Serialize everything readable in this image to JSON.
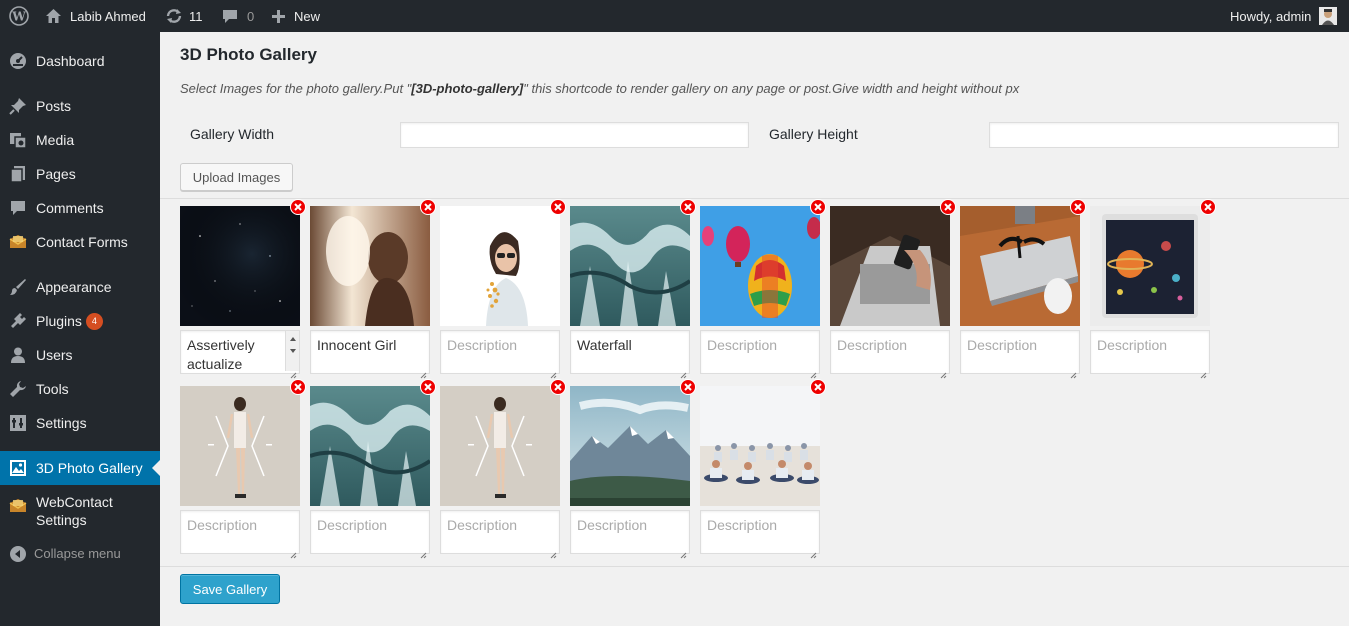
{
  "adminbar": {
    "site_name": "Labib Ahmed",
    "updates_count": "11",
    "comments_count": "0",
    "new_label": "New",
    "greeting": "Howdy, admin"
  },
  "sidebar": {
    "items": [
      {
        "label": "Dashboard",
        "icon": "dashboard-icon"
      },
      {
        "label": "Posts",
        "icon": "pin-icon"
      },
      {
        "label": "Media",
        "icon": "media-icon"
      },
      {
        "label": "Pages",
        "icon": "pages-icon"
      },
      {
        "label": "Comments",
        "icon": "comment-icon"
      },
      {
        "label": "Contact Forms",
        "icon": "contact-form-icon"
      },
      {
        "label": "Appearance",
        "icon": "brush-icon"
      },
      {
        "label": "Plugins",
        "icon": "plugin-icon",
        "badge": "4"
      },
      {
        "label": "Users",
        "icon": "users-icon"
      },
      {
        "label": "Tools",
        "icon": "wrench-icon"
      },
      {
        "label": "Settings",
        "icon": "settings-icon"
      },
      {
        "label": "3D Photo Gallery",
        "icon": "gallery-icon"
      },
      {
        "label": "WebContact Settings",
        "icon": "contact-form-icon"
      },
      {
        "label": "Collapse menu",
        "icon": "collapse-icon"
      }
    ],
    "active": "3D Photo Gallery"
  },
  "page": {
    "title": "3D Photo Gallery",
    "description_pre": "Select Images for the photo gallery.Put \"",
    "description_code": "[3D-photo-gallery]",
    "description_post": "\" this shortcode to render gallery on any page or post.Give width and height without px",
    "width_label": "Gallery Width",
    "width_value": "",
    "height_label": "Gallery Height",
    "height_value": "",
    "upload_button": "Upload Images",
    "save_button": "Save Gallery"
  },
  "gallery": {
    "placeholder": "Description",
    "items": [
      {
        "image": "night-sky-stars",
        "description": "Assertively actualize"
      },
      {
        "image": "woman-sunlight-silhouette",
        "description": "Innocent Girl"
      },
      {
        "image": "woman-sunglasses",
        "description": ""
      },
      {
        "image": "waterfall-closeup",
        "description": "Waterfall"
      },
      {
        "image": "hot-air-balloons",
        "description": ""
      },
      {
        "image": "laptop-phone-hands",
        "description": ""
      },
      {
        "image": "laptop-glasses-mouse",
        "description": ""
      },
      {
        "image": "space-poster-tablet",
        "description": ""
      },
      {
        "image": "woman-standing-light",
        "description": ""
      },
      {
        "image": "waterfall-closeup",
        "description": ""
      },
      {
        "image": "woman-standing-light",
        "description": ""
      },
      {
        "image": "mountain-landscape",
        "description": ""
      },
      {
        "image": "yoga-class",
        "description": ""
      }
    ]
  },
  "colors": {
    "adminbar_bg": "#23282d",
    "sidebar_active": "#0073aa",
    "primary_button": "#2ea2cc",
    "remove_button": "#ee0000",
    "plugin_badge": "#d54e21"
  }
}
